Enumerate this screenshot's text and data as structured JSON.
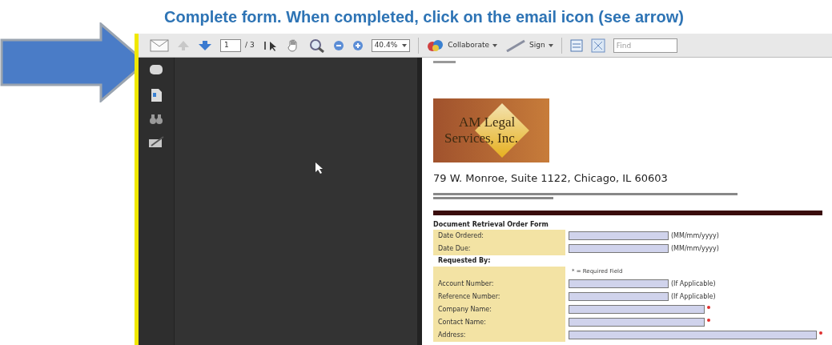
{
  "caption": "Complete form.  When completed, click on the email icon (see arrow)",
  "toolbar": {
    "page_current": "1",
    "page_total": "/ 3",
    "zoom": "40.4%",
    "collaborate": "Collaborate",
    "sign": "Sign",
    "find_placeholder": "Find"
  },
  "document": {
    "logo_lines": [
      "AM Legal",
      "Services, Inc."
    ],
    "address": "79 W. Monroe, Suite 1122, Chicago, IL 60603",
    "form_title": "Document Retrieval Order Form",
    "rows": [
      {
        "kind": "field",
        "label": "Date Ordered:",
        "note": "(MM/mm/yyyy)",
        "required": false
      },
      {
        "kind": "field",
        "label": "Date Due:",
        "note": "(MM/mm/yyyy)",
        "required": false
      },
      {
        "kind": "heading",
        "label": "Requested By:"
      },
      {
        "kind": "legend",
        "label": "* = Required Field"
      },
      {
        "kind": "field",
        "label": "Account Number:",
        "note": "(If Applicable)",
        "required": false
      },
      {
        "kind": "field",
        "label": "Reference Number:",
        "note": "(If Applicable)",
        "required": false
      },
      {
        "kind": "wide_field",
        "label": "Company Name:",
        "required": true
      },
      {
        "kind": "wide_field",
        "label": "Contact Name:",
        "required": true
      },
      {
        "kind": "full_field",
        "label": "Address:",
        "required": true
      }
    ]
  }
}
